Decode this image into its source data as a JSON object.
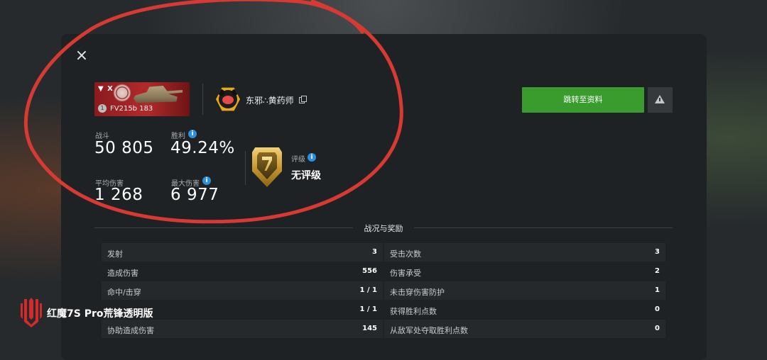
{
  "dialog": {
    "close_label": "×",
    "tank": {
      "tier": "▼ X",
      "name": "FV215b 183",
      "type_badge": "1"
    },
    "player": {
      "name": "东邪∴黄药师"
    },
    "actions": {
      "goto_profile": "跳转至资料"
    },
    "stats": [
      {
        "label": "战斗",
        "value": "50 805"
      },
      {
        "label": "胜利",
        "value": "49.24%"
      },
      {
        "label": "平均伤害",
        "value": "1 268"
      },
      {
        "label": "最大伤害",
        "value": "6 977"
      }
    ],
    "rating": {
      "label": "评级",
      "value": "无评级"
    },
    "section_title": "战况与奖励",
    "left_rows": [
      {
        "label": "发射",
        "value": "3"
      },
      {
        "label": "造成伤害",
        "value": "556"
      },
      {
        "label": "命中/击穿",
        "value": "1 / 1"
      },
      {
        "label": "",
        "value": "1 / 1"
      },
      {
        "label": "协助造成伤害",
        "value": "145"
      }
    ],
    "right_rows": [
      {
        "label": "受击次数",
        "value": "3"
      },
      {
        "label": "伤害承受",
        "value": "2"
      },
      {
        "label": "未击穿伤害防护",
        "value": "1"
      },
      {
        "label": "获得胜利点数",
        "value": "0"
      },
      {
        "label": "从敌军处夺取胜利点数",
        "value": "0"
      }
    ],
    "info_glyph": "i"
  },
  "watermark": {
    "text": "红魔7S Pro荒锋透明版"
  },
  "colors": {
    "accent_green": "#3b9c2e",
    "annotation_red": "#d63a32",
    "info_blue": "#2f8fd8",
    "gold": "#c9992f"
  }
}
